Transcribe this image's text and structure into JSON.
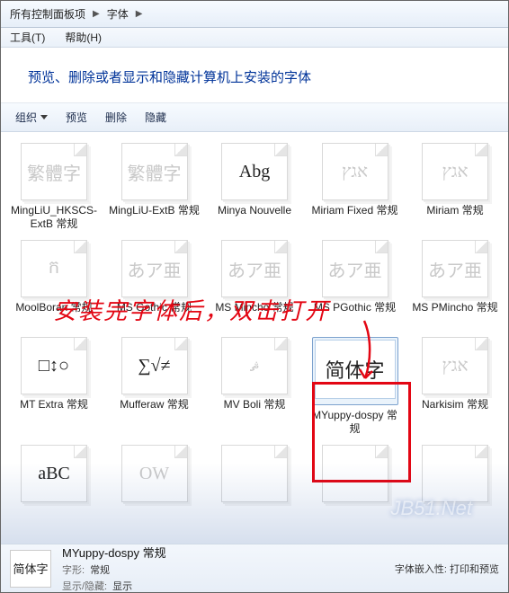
{
  "breadcrumb": {
    "item1": "所有控制面板项",
    "item2": "字体"
  },
  "menubar": {
    "tools": "工具(T)",
    "help": "帮助(H)"
  },
  "header": {
    "title": "预览、删除或者显示和隐藏计算机上安装的字体"
  },
  "toolbar": {
    "organize": "组织",
    "preview": "预览",
    "delete": "删除",
    "hide": "隐藏"
  },
  "annotation": {
    "text": "安装完字体后，双击打开"
  },
  "fonts": [
    {
      "label": "MingLiU_HKSCS-ExtB 常规",
      "sample": "繁體字",
      "faded": true
    },
    {
      "label": "MingLiU-ExtB 常规",
      "sample": "繁體字",
      "faded": true
    },
    {
      "label": "Minya Nouvelle",
      "sample": "Abg",
      "faded": false
    },
    {
      "label": "Miriam Fixed 常规",
      "sample": "אגץ",
      "faded": true
    },
    {
      "label": "Miriam 常规",
      "sample": "אגץ",
      "faded": true
    },
    {
      "label": "MoolBoran 常规",
      "sample": "ក",
      "faded": true
    },
    {
      "label": "MS Gothic 常规",
      "sample": "あア亜",
      "faded": true
    },
    {
      "label": "MS Mincho 常规",
      "sample": "あア亜",
      "faded": true
    },
    {
      "label": "MS PGothic 常规",
      "sample": "あア亜",
      "faded": true
    },
    {
      "label": "MS PMincho 常规",
      "sample": "あア亜",
      "faded": true
    },
    {
      "label": "MT Extra 常规",
      "sample": "□↕○",
      "faded": false
    },
    {
      "label": "Mufferaw 常规",
      "sample": "∑√≠",
      "faded": false
    },
    {
      "label": "MV Boli 常规",
      "sample": "ޘ",
      "faded": true
    },
    {
      "label": "MYuppy-dospy 常规",
      "sample": "简体字",
      "faded": false
    },
    {
      "label": "Narkisim 常规",
      "sample": "אגץ",
      "faded": true
    },
    {
      "label": "",
      "sample": "aBC",
      "faded": false
    },
    {
      "label": "",
      "sample": "OW",
      "faded": true
    },
    {
      "label": "",
      "sample": "",
      "faded": true
    },
    {
      "label": "",
      "sample": "",
      "faded": true
    },
    {
      "label": "",
      "sample": "",
      "faded": true
    }
  ],
  "details": {
    "mini_sample": "简体字",
    "title": "MYuppy-dospy 常规",
    "style_key": "字形:",
    "style_val": "常规",
    "show_key": "显示/隐藏:",
    "show_val": "显示",
    "embed_key": "字体嵌入性:",
    "embed_val": "打印和预览"
  },
  "watermark": "JB51.Net"
}
